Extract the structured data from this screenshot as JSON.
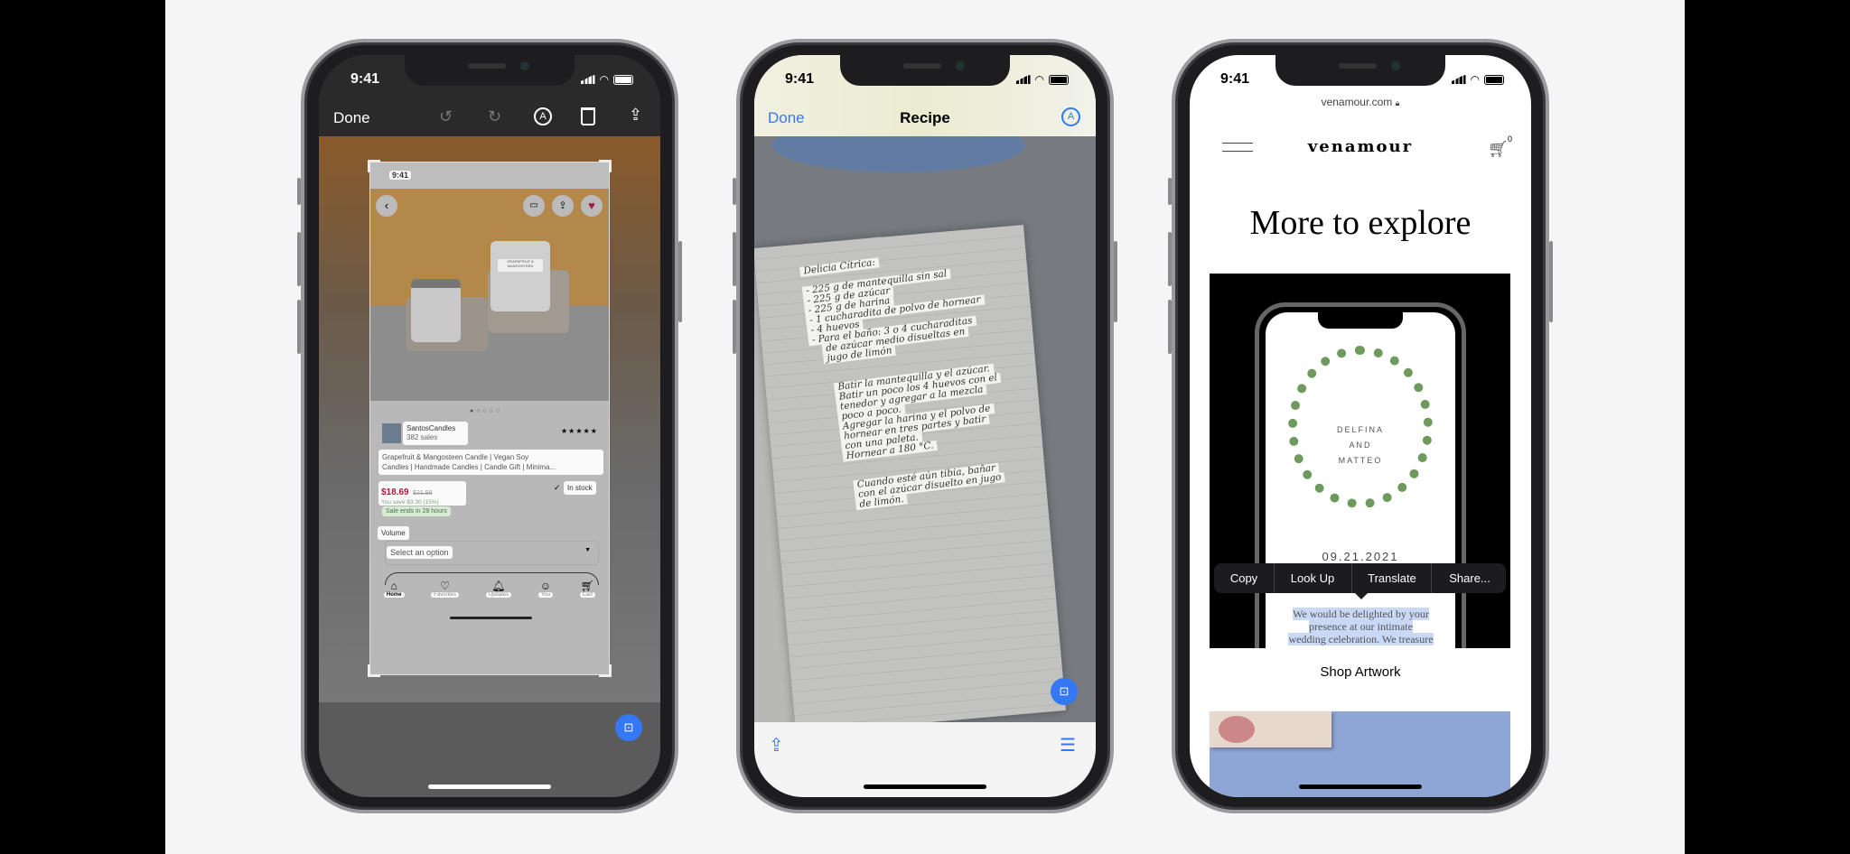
{
  "status_time": "9:41",
  "phone1": {
    "toolbar": {
      "done": "Done",
      "icons": [
        "undo-icon",
        "redo-icon",
        "markup-icon",
        "trash-icon",
        "share-icon"
      ]
    },
    "screenshot": {
      "time": "9:41",
      "seller": "SantosCandles",
      "sales": "382 sales",
      "rating": "★★★★★",
      "title_line1": "Grapefruit & Mangosteen Candle | Vegan Soy",
      "title_line2": "Candles | Handmade Candles | Candle Gift | Minima...",
      "price": "$18.69",
      "old_price": "$21.99",
      "savings": "You save $3.30 (15%)",
      "sale_ends": "Sale ends in 28 hours",
      "stock": "In stock",
      "volume_label": "Volume",
      "select": "Select an option",
      "tabs": [
        "Home",
        "Favorites",
        "Updates",
        "You",
        "Cart"
      ],
      "jar_label": "GRAPEFRUIT & MANGOSTEEN"
    }
  },
  "phone2": {
    "toolbar": {
      "done": "Done",
      "title": "Recipe"
    },
    "note_title": "Delicia Cítrica:",
    "ingredients": [
      "- 225 g de mantequilla sin sal",
      "- 225 g de azúcar",
      "- 225 g de harina",
      "- 1 cucharadita de polvo de hornear",
      "- 4 huevos",
      "- Para el baño: 3 o 4 cucharaditas",
      "de azúcar medio disueltas en",
      "jugo de limón"
    ],
    "steps": [
      "Batir la mantequilla y el azúcar.",
      "Batir un poco los 4 huevos con el",
      "tenedor y agregar a la mezcla",
      "poco a poco.",
      "Agregar la harina y el polvo de",
      "hornear en tres partes y batir",
      "con una paleta.",
      "Hornear a 180 °C."
    ],
    "finish": [
      "Cuando esté aún tibia, bañar",
      "con el azúcar disuelto en jugo",
      "de limón."
    ]
  },
  "phone3": {
    "url": "venamour.com",
    "logo": "venamour",
    "cart_count": "0",
    "heading": "More to explore",
    "invite": {
      "names": [
        "DELFINA",
        "AND",
        "MATTEO"
      ],
      "date": "09.21.2021"
    },
    "menu": [
      "Copy",
      "Look Up",
      "Translate",
      "Share..."
    ],
    "selected_text": [
      "We would be delighted by your",
      "presence at our intimate",
      "wedding celebration. We treasure"
    ],
    "shop": "Shop Artwork"
  },
  "colors": {
    "accent": "#3478f6",
    "price": "#a2203c",
    "sale_bg": "#d7ead4",
    "selection": "#c8d8f5"
  }
}
